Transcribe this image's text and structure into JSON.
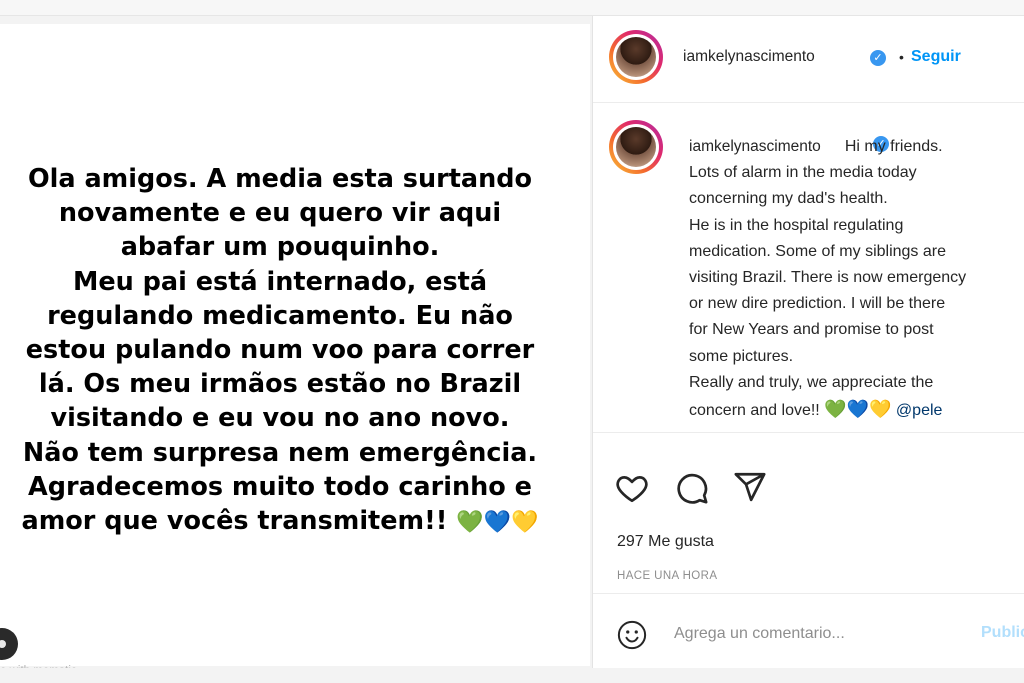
{
  "post_image": {
    "text": "Ola amigos. A media esta surtando\nnovamente e eu quero vir aqui\nabafar um pouquinho.\nMeu pai está internado, está\nregulando medicamento. Eu não\nestou pulando num voo para correr\nlá. Os meu irmãos estão no Brazil\nvisitando e eu vou no ano novo.\nNão tem surpresa nem emergência.\nAgradecemos muito todo carinho e\namor que vocês transmitem!!",
    "hearts": [
      "💚",
      "💙",
      "💛"
    ],
    "watermark": "e with mematic"
  },
  "header": {
    "username": "iamkelynascimento",
    "verified_icon": "verified-badge-icon",
    "separator": "•",
    "follow_label": "Seguir"
  },
  "caption": {
    "username": "iamkelynascimento",
    "text": "Hi my friends.\nLots of alarm in the media today\nconcerning my dad's health.\nHe is in the hospital regulating\nmedication. Some of my siblings are\nvisiting Brazil. There is now emergency\nor new dire prediction. I will be there\nfor New Years and promise to post\nsome pictures.\nReally and truly, we appreciate the\nconcern and love!!",
    "hearts": [
      "💚",
      "💙",
      "💛"
    ],
    "mention": "@pele"
  },
  "actions": {
    "icons": [
      "heart-icon",
      "comment-icon",
      "share-icon"
    ],
    "likes": "297 Me gusta",
    "timestamp": "HACE UNA HORA"
  },
  "comment": {
    "emoji_icon": "emoji-icon",
    "placeholder": "Agrega un comentario...",
    "publish_label": "Publicar"
  },
  "colors": {
    "link_blue": "#0095f6",
    "mention_blue": "#00376b",
    "verified_blue": "#3897f0",
    "publish_disabled": "#b2dffc"
  }
}
